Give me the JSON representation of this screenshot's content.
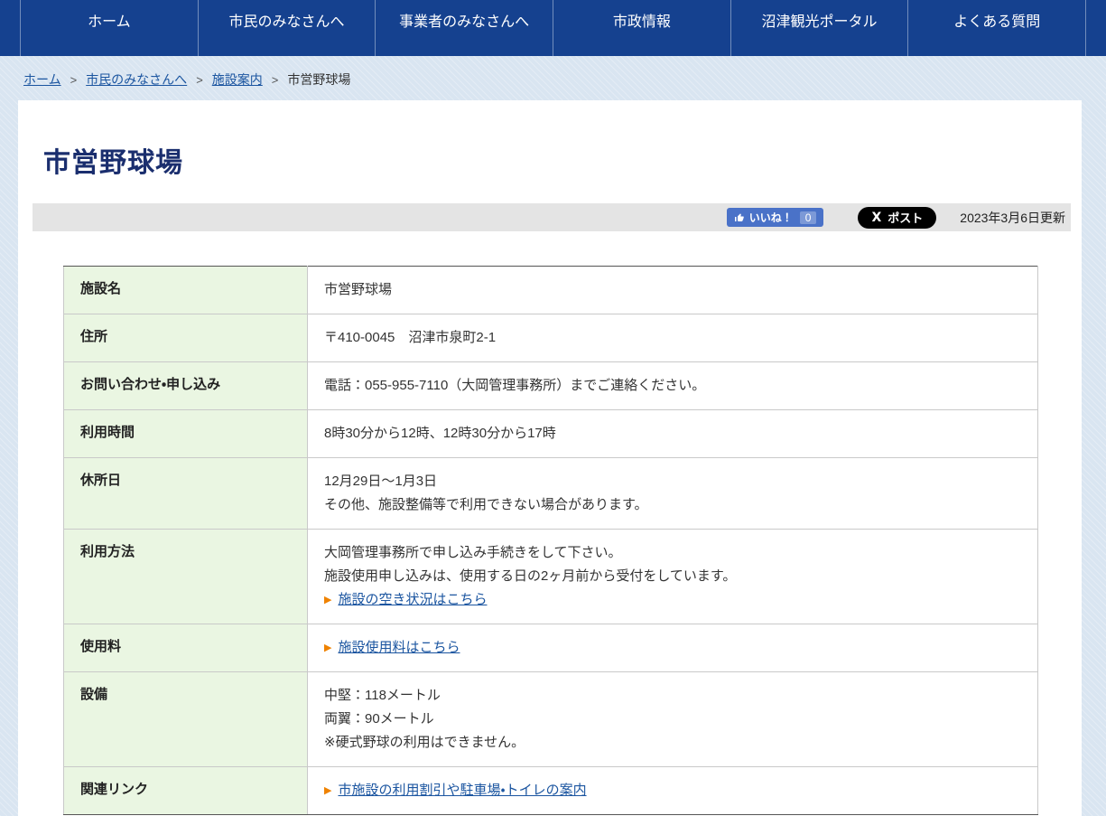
{
  "nav": {
    "items": [
      {
        "label": "ホーム"
      },
      {
        "label": "市民のみなさんへ"
      },
      {
        "label": "事業者のみなさんへ"
      },
      {
        "label": "市政情報"
      },
      {
        "label": "沼津観光ポータル"
      },
      {
        "label": "よくある質問"
      }
    ]
  },
  "breadcrumb": {
    "separator": ">",
    "items": [
      {
        "label": "ホーム",
        "link": true
      },
      {
        "label": "市民のみなさんへ",
        "link": true
      },
      {
        "label": "施設案内",
        "link": true
      },
      {
        "label": "市営野球場",
        "link": false
      }
    ]
  },
  "page": {
    "title": "市営野球場"
  },
  "social": {
    "like_label": "いいね！",
    "like_count": "0",
    "x_logo": "X",
    "post_label": "ポスト",
    "updated": "2023年3月6日更新"
  },
  "table": {
    "rows": [
      {
        "label": "施設名",
        "lines": [
          {
            "type": "text",
            "text": "市営野球場"
          }
        ]
      },
      {
        "label": "住所",
        "lines": [
          {
            "type": "text",
            "text": "〒410-0045　沼津市泉町2-1"
          }
        ]
      },
      {
        "label": "お問い合わせ・申し込み",
        "lines": [
          {
            "type": "text",
            "text": "電話：055-955-7110（大岡管理事務所）までご連絡ください。"
          }
        ]
      },
      {
        "label": "利用時間",
        "lines": [
          {
            "type": "text",
            "text": "8時30分から12時、12時30分から17時"
          }
        ]
      },
      {
        "label": "休所日",
        "lines": [
          {
            "type": "text",
            "text": "12月29日～1月3日"
          },
          {
            "type": "text",
            "text": "その他、施設整備等で利用できない場合があります。"
          }
        ]
      },
      {
        "label": "利用方法",
        "lines": [
          {
            "type": "text",
            "text": "大岡管理事務所で申し込み手続きをして下さい。"
          },
          {
            "type": "text",
            "text": "施設使用申し込みは、使用する日の2ヶ月前から受付をしています。"
          },
          {
            "type": "link",
            "text": "施設の空き状況はこちら"
          }
        ]
      },
      {
        "label": "使用料",
        "lines": [
          {
            "type": "link",
            "text": "施設使用料はこちら"
          }
        ]
      },
      {
        "label": "設備",
        "lines": [
          {
            "type": "text",
            "text": "中堅：118メートル"
          },
          {
            "type": "text",
            "text": "両翼：90メートル"
          },
          {
            "type": "text",
            "text": "※硬式野球の利用はできません。"
          }
        ]
      },
      {
        "label": "関連リンク",
        "lines": [
          {
            "type": "link",
            "text": "市施設の利用割引や駐車場・トイレの案内"
          }
        ]
      }
    ]
  },
  "colors": {
    "nav_bg": "#15418f",
    "page_bg": "#d9e5f1",
    "title": "#1a2e6e",
    "link": "#1b55a0",
    "label_cell_bg": "#eaf6e2",
    "facebook_blue": "#4a72c8",
    "x_black": "#000000",
    "arrow_orange": "#ef8200"
  }
}
